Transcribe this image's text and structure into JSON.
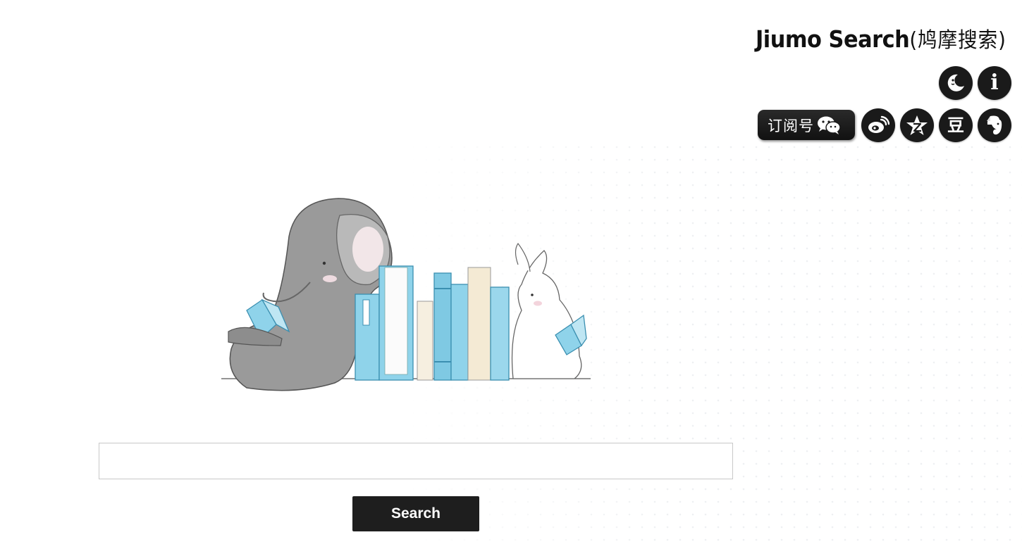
{
  "header": {
    "brand_latin": "Jiumo Search",
    "brand_cn": "(鸠摩搜索)"
  },
  "toolbar": {
    "night_mode_icon": "moon-icon",
    "info_icon": "info-icon",
    "info_glyph": "i"
  },
  "social": {
    "wechat_label": "订阅号",
    "wechat_icon": "wechat-icon",
    "weibo_icon": "weibo-icon",
    "zhihu_icon": "star-icon",
    "douban_glyph": "豆",
    "douban_icon": "douban-icon",
    "evernote_icon": "evernote-icon"
  },
  "illustration": {
    "icon": "elephant-bunny-books-illustration"
  },
  "search": {
    "input_value": "",
    "placeholder": "",
    "button_label": "Search"
  },
  "colors": {
    "button_bg": "#1e1e1e",
    "book_blue": "#8fd3ea",
    "elephant_gray": "#8f8f8f"
  }
}
